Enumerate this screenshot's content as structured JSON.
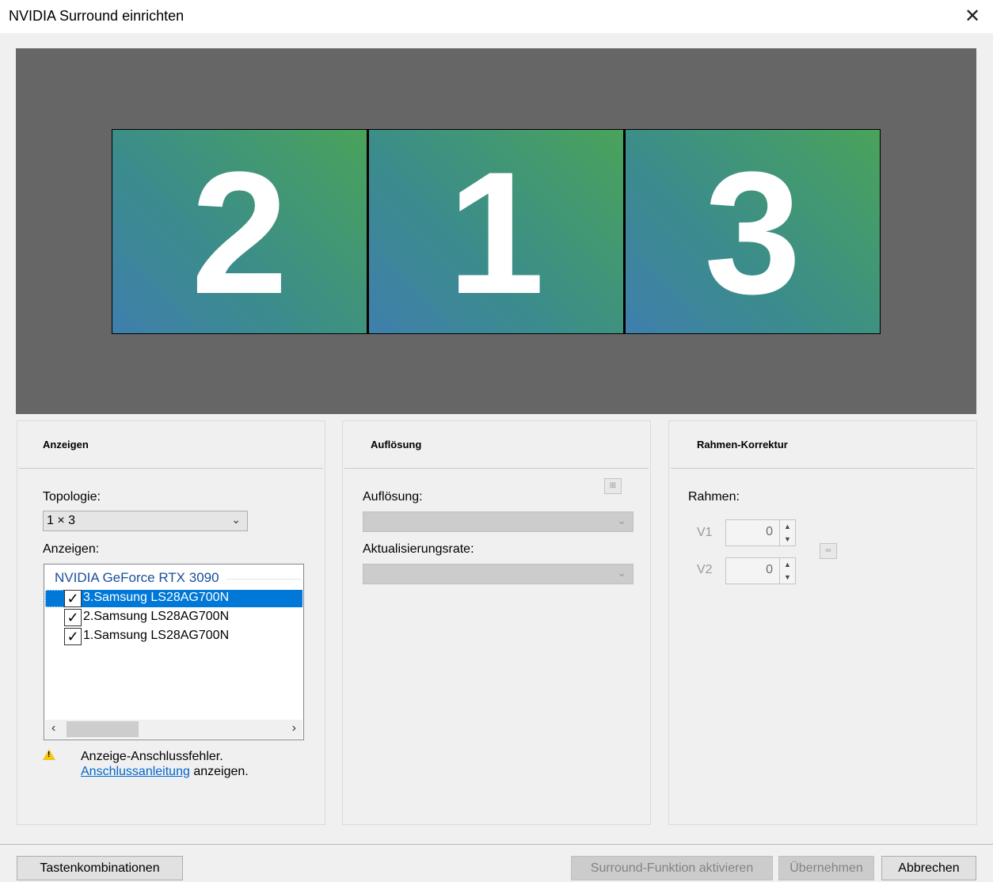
{
  "window": {
    "title": "NVIDIA Surround einrichten",
    "close_glyph": "✕"
  },
  "preview": {
    "monitors": [
      "2",
      "1",
      "3"
    ]
  },
  "panels": {
    "displays": {
      "title": "Anzeigen",
      "topology_label": "Topologie:",
      "topology_value": "1 × 3",
      "displays_label": "Anzeigen:",
      "gpu": "NVIDIA GeForce RTX 3090",
      "items": [
        "3.Samsung LS28AG700N",
        "2.Samsung LS28AG700N",
        "1.Samsung LS28AG700N"
      ],
      "warning_text": "Anzeige-Anschlussfehler.",
      "warning_link": "Anschlussanleitung",
      "warning_suffix": " anzeigen."
    },
    "resolution": {
      "title": "Auflösung",
      "resolution_label": "Auflösung:",
      "refresh_label": "Aktualisierungsrate:"
    },
    "bezel": {
      "title": "Rahmen-Korrektur",
      "bezel_label": "Rahmen:",
      "v1_label": "V1",
      "v1_value": "0",
      "v2_label": "V2",
      "v2_value": "0"
    }
  },
  "footer": {
    "shortcuts": "Tastenkombinationen",
    "enable_surround": "Surround-Funktion aktivieren",
    "apply": "Übernehmen",
    "cancel": "Abbrechen"
  },
  "colors": {
    "selection": "#0078d7",
    "link": "#0066cc",
    "gpu_label": "#1a4e9c"
  }
}
